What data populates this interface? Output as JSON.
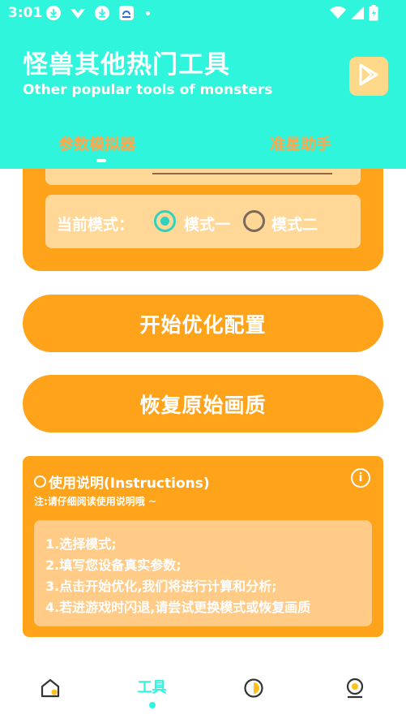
{
  "status_bar": {
    "time": "3:01"
  },
  "header": {
    "title": "怪兽其他热门工具",
    "subtitle": "Other popular tools of monsters",
    "tabs": [
      {
        "label": "参数模拟器",
        "active": true
      },
      {
        "label": "准星助手",
        "active": false
      }
    ]
  },
  "settings": {
    "mode_label": "当前模式：",
    "modes": [
      {
        "label": "模式一",
        "selected": true
      },
      {
        "label": "模式二",
        "selected": false
      }
    ]
  },
  "buttons": {
    "optimize": "开始优化配置",
    "restore": "恢复原始画质"
  },
  "instructions": {
    "title": "使用说明(Instructions)",
    "note": "注:请仔细阅读使用说明哦 ~",
    "steps": [
      "1.选择模式;",
      "2.填写您设备真实参数;",
      "3.点击开始优化,我们将进行计算和分析;",
      "4.若进游戏时闪退,请尝试更换模式或恢复画质"
    ]
  },
  "bottom_nav": {
    "items": [
      {
        "name": "home",
        "label": ""
      },
      {
        "name": "tools",
        "label": "工具",
        "active": true
      },
      {
        "name": "stats",
        "label": ""
      },
      {
        "name": "profile",
        "label": ""
      }
    ]
  },
  "colors": {
    "header_bg": "#2ff5dc",
    "accent_orange": "#ffa31a",
    "panel_light": "#ffd797",
    "radio_selected": "#2fd2bd"
  }
}
